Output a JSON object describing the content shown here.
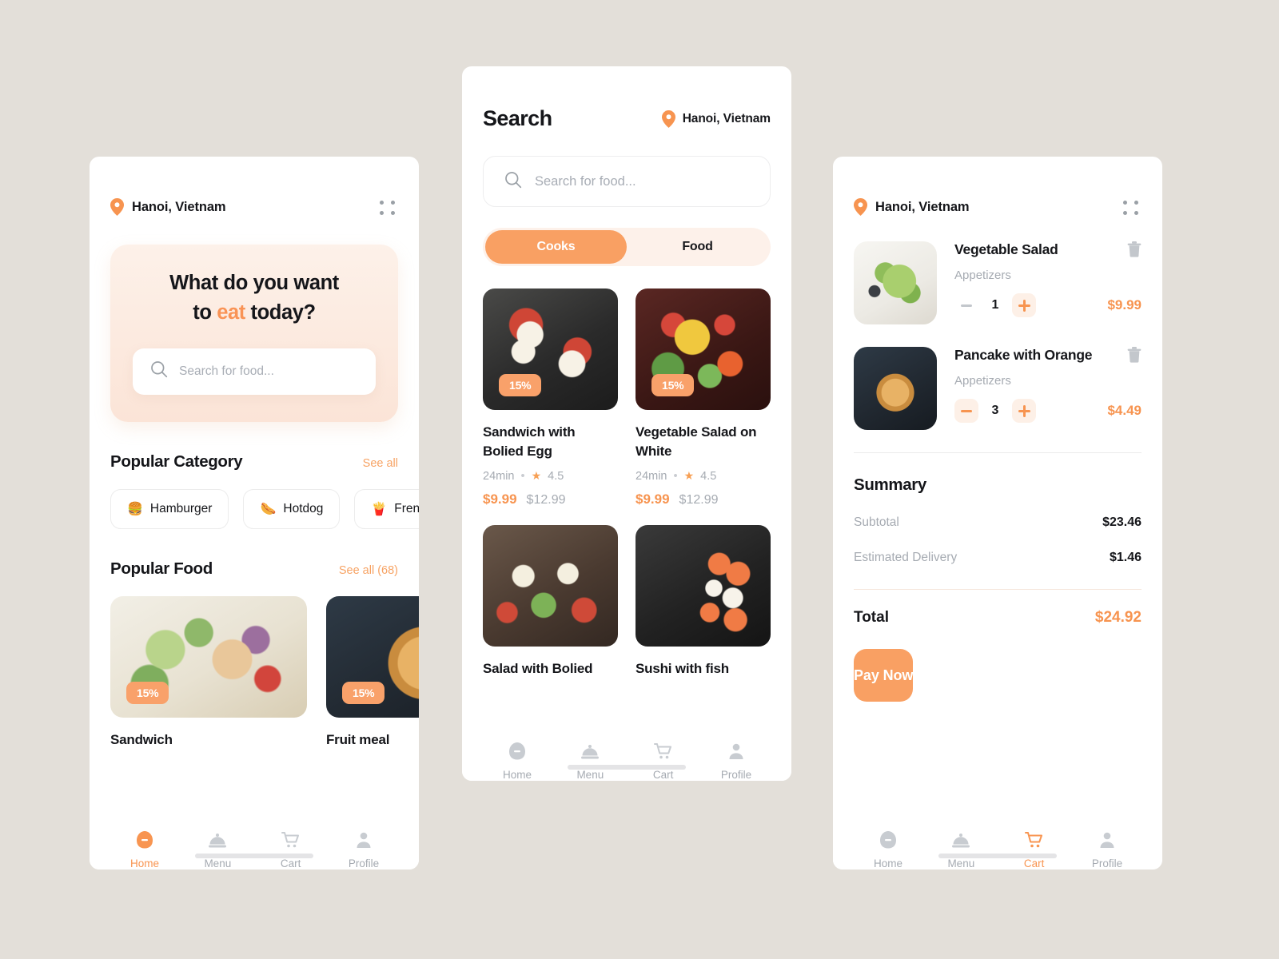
{
  "colors": {
    "accent": "#f9a063",
    "accent_text": "#f79450",
    "page_bg": "#e3dfd9",
    "panel_bg": "#ffffff",
    "hero_top": "#fdf1e9",
    "hero_bottom": "#fbe4d7",
    "muted": "#a6abb2"
  },
  "home": {
    "location": "Hanoi, Vietnam",
    "menu_icon": "grid-dots-icon",
    "pin_icon": "location-pin-icon",
    "hero": {
      "line1": "What do you want",
      "line2_before": "to ",
      "line2_accent": "eat",
      "line2_after": " today?",
      "search_placeholder": "Search for food...",
      "search_value": "",
      "search_icon": "search-icon"
    },
    "popular_category": {
      "title": "Popular Category",
      "see_all": "See all",
      "chips": [
        {
          "emoji": "🍔",
          "label": "Hamburger",
          "icon": "hamburger-icon"
        },
        {
          "emoji": "🌭",
          "label": "Hotdog",
          "icon": "hotdog-icon"
        },
        {
          "emoji": "🍟",
          "label": "French fries",
          "icon": "fries-icon"
        }
      ]
    },
    "popular_food": {
      "title": "Popular Food",
      "see_all": "See all (68)",
      "items": [
        {
          "name": "Sandwich",
          "badge": "15%",
          "art": "img-salad-chicken"
        },
        {
          "name": "Fruit meal",
          "badge": "15%",
          "art": "img-pancake"
        }
      ]
    },
    "tabs": [
      {
        "label": "Home",
        "icon": "home-icon",
        "active": true
      },
      {
        "label": "Menu",
        "icon": "cloche-icon",
        "active": false
      },
      {
        "label": "Cart",
        "icon": "cart-icon",
        "active": false
      },
      {
        "label": "Profile",
        "icon": "profile-icon",
        "active": false
      }
    ]
  },
  "search": {
    "title": "Search",
    "location": "Hanoi, Vietnam",
    "pin_icon": "location-pin-icon",
    "search_placeholder": "Search for food...",
    "search_value": "",
    "search_icon": "search-icon",
    "toggle": [
      {
        "label": "Cooks",
        "active": true
      },
      {
        "label": "Food",
        "active": false
      }
    ],
    "results": [
      {
        "name": "Sandwich with Bolied Egg",
        "badge": "15%",
        "time": "24min",
        "rating": "4.5",
        "price_now": "$9.99",
        "price_was": "$12.99",
        "art": "img-eggsand"
      },
      {
        "name": "Vegetable Salad on White",
        "badge": "15%",
        "time": "24min",
        "rating": "4.5",
        "price_now": "$9.99",
        "price_was": "$12.99",
        "art": "img-vegsalad"
      },
      {
        "name": "Salad with Bolied",
        "badge": "",
        "time": "",
        "rating": "",
        "price_now": "",
        "price_was": "",
        "art": "img-saladboiled"
      },
      {
        "name": "Sushi with fish",
        "badge": "",
        "time": "",
        "rating": "",
        "price_now": "",
        "price_was": "",
        "art": "img-sushi"
      }
    ],
    "tabs": [
      {
        "label": "Home",
        "icon": "home-icon",
        "active": false
      },
      {
        "label": "Menu",
        "icon": "cloche-icon",
        "active": false
      },
      {
        "label": "Cart",
        "icon": "cart-icon",
        "active": false
      },
      {
        "label": "Profile",
        "icon": "profile-icon",
        "active": false
      }
    ]
  },
  "cart": {
    "location": "Hanoi, Vietnam",
    "menu_icon": "grid-dots-icon",
    "pin_icon": "location-pin-icon",
    "items": [
      {
        "name": "Vegetable Salad",
        "category": "Appetizers",
        "qty": "1",
        "price": "$9.99",
        "minus_active": false,
        "delete_icon": "trash-icon",
        "art": "img-vegsalad-plate"
      },
      {
        "name": "Pancake with Orange",
        "category": "Appetizers",
        "qty": "3",
        "price": "$4.49",
        "minus_active": true,
        "delete_icon": "trash-icon",
        "art": "img-pancake"
      }
    ],
    "summary": {
      "title": "Summary",
      "rows": [
        {
          "label": "Subtotal",
          "value": "$23.46"
        },
        {
          "label": "Estimated Delivery",
          "value": "$1.46"
        }
      ],
      "total_label": "Total",
      "total_value": "$24.92"
    },
    "pay_label": "Pay Now",
    "tabs": [
      {
        "label": "Home",
        "icon": "home-icon",
        "active": false
      },
      {
        "label": "Menu",
        "icon": "cloche-icon",
        "active": false
      },
      {
        "label": "Cart",
        "icon": "cart-icon",
        "active": true
      },
      {
        "label": "Profile",
        "icon": "profile-icon",
        "active": false
      }
    ]
  }
}
